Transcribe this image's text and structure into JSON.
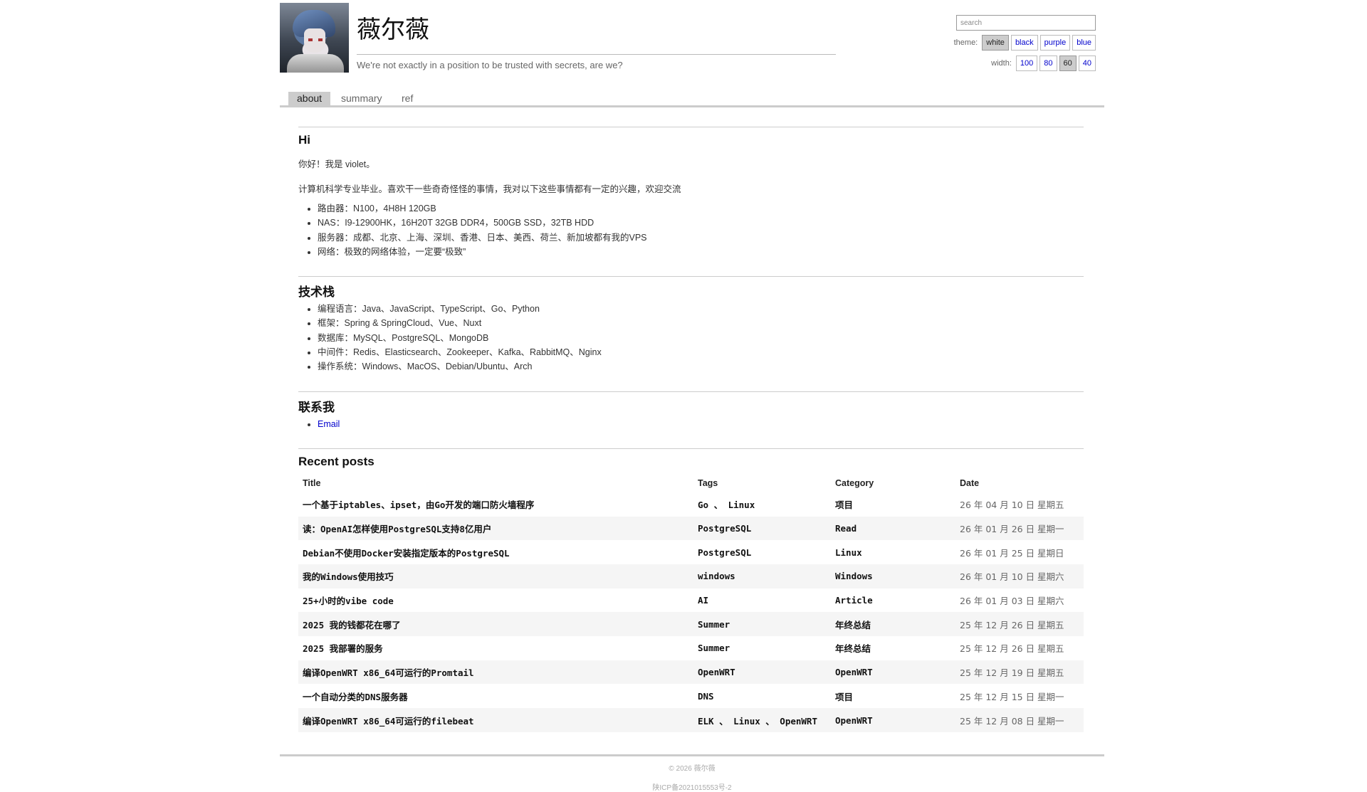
{
  "site": {
    "title": "薇尔薇",
    "tagline": "We're not exactly in a position to be trusted with secrets, are we?"
  },
  "search": {
    "placeholder": "search"
  },
  "theme": {
    "label": "theme:",
    "options": [
      "white",
      "black",
      "purple",
      "blue"
    ],
    "selected": "white"
  },
  "width": {
    "label": "width:",
    "options": [
      "100",
      "80",
      "60",
      "40"
    ],
    "selected": "60"
  },
  "nav": {
    "tabs": [
      "about",
      "summary",
      "ref"
    ],
    "active": "about"
  },
  "about": {
    "heading": "Hi",
    "intro": "你好！我是 violet。",
    "desc": "计算机科学专业毕业。喜欢干一些奇奇怪怪的事情，我对以下这些事情都有一定的兴趣，欢迎交流",
    "items": [
      "路由器：N100，4H8H 120GB",
      "NAS：I9-12900HK，16H20T 32GB DDR4，500GB SSD，32TB HDD",
      "服务器：成都、北京、上海、深圳、香港、日本、美西、荷兰、新加坡都有我的VPS",
      "网络：极致的网络体验，一定要“极致”"
    ]
  },
  "stack": {
    "heading": "技术栈",
    "items": [
      "编程语言：Java、JavaScript、TypeScript、Go、Python",
      "框架：Spring & SpringCloud、Vue、Nuxt",
      "数据库：MySQL、PostgreSQL、MongoDB",
      "中间件：Redis、Elasticsearch、Zookeeper、Kafka、RabbitMQ、Nginx",
      "操作系统：Windows、MacOS、Debian/Ubuntu、Arch"
    ]
  },
  "contact": {
    "heading": "联系我",
    "email_label": "Email"
  },
  "posts": {
    "heading": "Recent posts",
    "columns": [
      "Title",
      "Tags",
      "Category",
      "Date"
    ],
    "rows": [
      {
        "title": "一个基于iptables、ipset，由Go开发的端口防火墙程序",
        "tags": "Go 、 Linux",
        "category": "项目",
        "date": "26 年 04 月 10 日 星期五"
      },
      {
        "title": "读：OpenAI怎样使用PostgreSQL支持8亿用户",
        "tags": "PostgreSQL",
        "category": "Read",
        "date": "26 年 01 月 26 日 星期一"
      },
      {
        "title": "Debian不使用Docker安装指定版本的PostgreSQL",
        "tags": "PostgreSQL",
        "category": "Linux",
        "date": "26 年 01 月 25 日 星期日"
      },
      {
        "title": "我的Windows使用技巧",
        "tags": "windows",
        "category": "Windows",
        "date": "26 年 01 月 10 日 星期六"
      },
      {
        "title": "25+小时的vibe code",
        "tags": "AI",
        "category": "Article",
        "date": "26 年 01 月 03 日 星期六"
      },
      {
        "title": "2025 我的钱都花在哪了",
        "tags": "Summer",
        "category": "年终总结",
        "date": "25 年 12 月 26 日 星期五"
      },
      {
        "title": "2025 我部署的服务",
        "tags": "Summer",
        "category": "年终总结",
        "date": "25 年 12 月 26 日 星期五"
      },
      {
        "title": "编译OpenWRT x86_64可运行的Promtail",
        "tags": "OpenWRT",
        "category": "OpenWRT",
        "date": "25 年 12 月 19 日 星期五"
      },
      {
        "title": "一个自动分类的DNS服务器",
        "tags": "DNS",
        "category": "项目",
        "date": "25 年 12 月 15 日 星期一"
      },
      {
        "title": "编译OpenWRT x86_64可运行的filebeat",
        "tags": "ELK 、 Linux 、 OpenWRT",
        "category": "OpenWRT",
        "date": "25 年 12 月 08 日 星期一"
      }
    ]
  },
  "footer": {
    "copyright": "© 2026 薇尔薇",
    "icp": "陕ICP备2021015553号-2"
  },
  "colors": {
    "link": "#0000cc",
    "active_tab": "#cccccc",
    "rule": "#cccccc"
  }
}
